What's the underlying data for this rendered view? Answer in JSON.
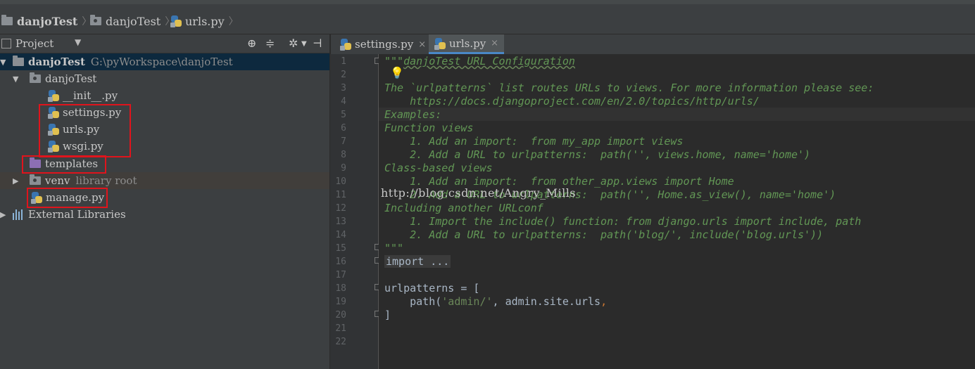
{
  "breadcrumb": {
    "items": [
      "danjoTest",
      "danjoTest",
      "urls.py"
    ],
    "separator": "〉"
  },
  "project_panel": {
    "title": "Project",
    "tools": {
      "scope_icon": "target-icon",
      "collapse_icon": "collapse-all-icon",
      "settings_icon": "gear-icon",
      "hide_icon": "hide-panel-icon"
    },
    "tree": [
      {
        "label": "danjoTest",
        "suffix": "G:\\pyWorkspace\\danjoTest",
        "type": "folder",
        "expanded": true
      },
      {
        "label": "danjoTest",
        "type": "package",
        "expanded": true
      },
      {
        "label": "__init__.py",
        "type": "python-file"
      },
      {
        "label": "settings.py",
        "type": "python-file"
      },
      {
        "label": "urls.py",
        "type": "python-file"
      },
      {
        "label": "wsgi.py",
        "type": "python-file"
      },
      {
        "label": "templates",
        "type": "templates-folder"
      },
      {
        "label": "venv",
        "suffix": "library root",
        "type": "folder",
        "expanded": false
      },
      {
        "label": "manage.py",
        "type": "python-file"
      },
      {
        "label": "External Libraries",
        "type": "libraries"
      }
    ]
  },
  "editor": {
    "tabs": [
      {
        "label": "settings.py",
        "active": false,
        "close": "×"
      },
      {
        "label": "urls.py",
        "active": true,
        "close": "×"
      }
    ],
    "line_numbers": [
      "1",
      "2",
      "3",
      "4",
      "5",
      "6",
      "7",
      "8",
      "9",
      "10",
      "11",
      "12",
      "13",
      "14",
      "15",
      "16",
      "17",
      "18",
      "19",
      "20",
      "21",
      "22"
    ],
    "code": {
      "l1_quote": "\"\"\"",
      "l1_text": "danjoTest URL Configuration",
      "l3": "The `urlpatterns` list routes URLs to views. For more information please see:",
      "l4": "    https://docs.djangoproject.com/en/2.0/topics/http/urls/",
      "l5": "Examples:",
      "l6": "Function views",
      "l7": "    1. Add an import:  from my_app import views",
      "l8": "    2. Add a URL to urlpatterns:  path('', views.home, name='home')",
      "l9": "Class-based views",
      "l10": "    1. Add an import:  from other_app.views import Home",
      "l11": "    2. Add a URL to urlpatterns:  path('', Home.as_view(), name='home')",
      "l12": "Including another URLconf",
      "l13": "    1. Import the include() function: from django.urls import include, path",
      "l14": "    2. Add a URL to urlpatterns:  path('blog/', include('blog.urls'))",
      "l15": "\"\"\"",
      "l16": "import ...",
      "l19": "urlpatterns = [",
      "l20_a": "    path(",
      "l20_b": "'admin/'",
      "l20_c": ", admin.site.urls",
      "l20_d": ",",
      "l21": "]"
    },
    "watermark": "http://blog.csdn.net/Angry_Mills"
  },
  "colors": {
    "highlight_box": "#e0141c",
    "docstring": "#629755",
    "keyword": "#cc7832",
    "string": "#6a8759",
    "selection": "#0d293e"
  }
}
